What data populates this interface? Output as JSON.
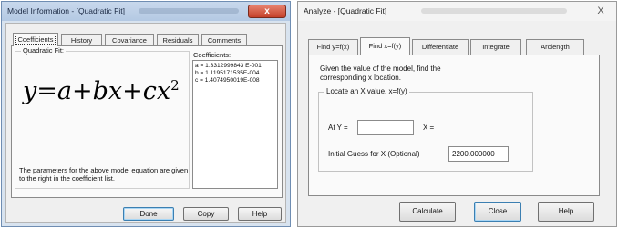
{
  "left_window": {
    "title": "Model Information - [Quadratic Fit]",
    "close_label": "x",
    "tabs": [
      {
        "label": "Coefficients",
        "active": true
      },
      {
        "label": "History",
        "active": false
      },
      {
        "label": "Covariance",
        "active": false
      },
      {
        "label": "Residuals",
        "active": false
      },
      {
        "label": "Comments",
        "active": false
      }
    ],
    "equation_panel": {
      "label": "Quadratic Fit:",
      "equation": {
        "lhs": "y",
        "eq": "=",
        "a": "a",
        "plus1": "+",
        "b": "b",
        "x1": "x",
        "plus2": "+",
        "c": "c",
        "x2": "x",
        "exp": "2"
      },
      "note": "The parameters for the above model equation are given to the right in the coefficient list."
    },
    "coefficients": {
      "label": "Coefficients:",
      "rows": [
        "a = 1.3312999843 E-001",
        "b = 1.1195171535E-004",
        "c = 1.4074950019E-008"
      ]
    },
    "buttons": {
      "done": "Done",
      "copy": "Copy",
      "help": "Help"
    }
  },
  "right_window": {
    "title": "Analyze - [Quadratic Fit]",
    "close_label": "X",
    "tabs": [
      {
        "label": "Find y=f(x)",
        "active": false
      },
      {
        "label": "Find x=f(y)",
        "active": true
      },
      {
        "label": "Differentiate",
        "active": false
      },
      {
        "label": "Integrate",
        "active": false
      },
      {
        "label": "Arclength",
        "active": false
      }
    ],
    "instructions": [
      "Given the value of the model, find the",
      "corresponding x location."
    ],
    "group_label": "Locate an X value, x=f(y)",
    "at_y_label": "At Y =",
    "at_y_value": "",
    "x_result_label": "X =",
    "initial_guess_label": "Initial Guess for X (Optional)",
    "initial_guess_value": "2200.000000",
    "buttons": {
      "calculate": "Calculate",
      "close": "Close",
      "help": "Help"
    }
  }
}
